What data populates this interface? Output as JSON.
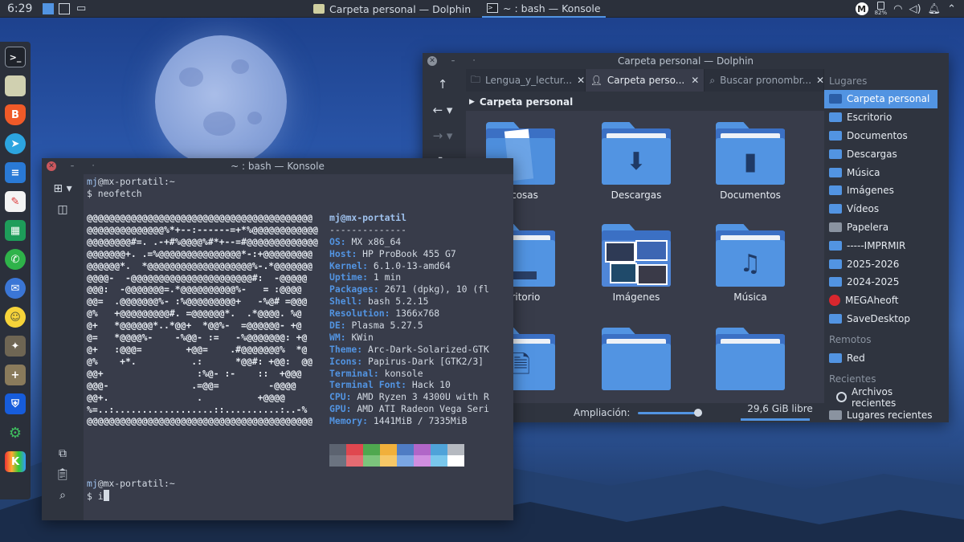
{
  "top_panel": {
    "clock": "6:29",
    "tasks": [
      {
        "title": "Carpeta personal — Dolphin",
        "active": false
      },
      {
        "title": "~ : bash — Konsole",
        "active": true
      }
    ],
    "battery": "82%"
  },
  "dock": {
    "icons": [
      "terminal-icon",
      "files-icon",
      "brave-icon",
      "telegram-icon",
      "writer-icon",
      "editor-icon",
      "sheets-icon",
      "chat-icon",
      "thunderbird-icon",
      "emoji-icon",
      "gimp-icon",
      "add-app-icon",
      "bitwarden-icon",
      "settings-icon",
      "kvirc-icon"
    ]
  },
  "dolphin": {
    "title": "Carpeta personal — Dolphin",
    "tabs": [
      "Lengua_y_lectur...",
      "Carpeta perso...",
      "Buscar pronombr..."
    ],
    "path": "Carpeta personal",
    "folders": [
      {
        "label": "+cosas",
        "glyph": ""
      },
      {
        "label": "Descargas",
        "glyph": "⬇"
      },
      {
        "label": "Documentos",
        "glyph": "▮"
      },
      {
        "label": "scritorio",
        "glyph": ""
      },
      {
        "label": "Imágenes",
        "glyph": ""
      },
      {
        "label": "Música",
        "glyph": "♫"
      },
      {
        "label": "",
        "glyph": "🗎"
      },
      {
        "label": "",
        "glyph": ""
      },
      {
        "label": "",
        "glyph": ""
      }
    ],
    "status": {
      "zoom_label": "Ampliación:",
      "free": "29,6 GiB libre",
      "edge_char": "s"
    },
    "places": {
      "head_lugares": "Lugares",
      "lugares": [
        "Carpeta personal",
        "Escritorio",
        "Documentos",
        "Descargas",
        "Música",
        "Imágenes",
        "Vídeos",
        "Papelera",
        "-----IMPRMIR",
        "2025-2026",
        "2024-2025",
        "MEGAheoft",
        "SaveDesktop"
      ],
      "head_remotos": "Remotos",
      "remotos": [
        "Red"
      ],
      "head_recientes": "Recientes",
      "recientes": [
        "Archivos recientes",
        "Lugares recientes"
      ]
    }
  },
  "konsole": {
    "title": "~ : bash — Konsole",
    "prompt_user": "mj",
    "prompt_host": "@mx-portatil",
    "prompt_path": ":~",
    "cmd1": "$ neofetch",
    "cmd2_prefix": "$ ",
    "cmd2_typed": "i",
    "art": "@@@@@@@@@@@@@@@@@@@@@@@@@@@@@@@@@@@@@@@@@\n@@@@@@@@@@@@@@%*+--:------=+*%@@@@@@@@@@@@\n@@@@@@@@#=. .-+#%@@@@%#*+--=#@@@@@@@@@@@@@\n@@@@@@@+. .=%@@@@@@@@@@@@@@@*-:+@@@@@@@@@\n@@@@@@*.  *@@@@@@@@@@@@@@@@@@@%-.*@@@@@@@\n@@@@-  -@@@@@@@@@@@@@@@@@@@@@@#:  -@@@@@\n@@@:  -@@@@@@@=.*@@@@@@@@@@%-   = :@@@@\n@@=  .@@@@@@@%- :%@@@@@@@@@+   -%@# =@@@\n@%   +@@@@@@@@@#. =@@@@@@*.  .*@@@@. %@\n@+   *@@@@@@*..*@@+  *@@%-  =@@@@@@- +@\n@=   *@@@@%-    -%@@- :=   -%@@@@@@@: +@\n@+   :@@@=        +@@=    .#@@@@@@@%  *@\n@%    +*.          .:      *@@#: +@@:  @@\n@@+                 :%@- :-    ::  +@@@\n@@@-               .=@@=         -@@@@\n@@+.                .          +@@@@\n%=..:..................::..........:..-%\n@@@@@@@@@@@@@@@@@@@@@@@@@@@@@@@@@@@@@@@@@",
    "info_header": "mj@mx-portatil",
    "info_sep": "--------------",
    "info": [
      {
        "k": "OS",
        "v": "MX x86_64"
      },
      {
        "k": "Host",
        "v": "HP ProBook 455 G7"
      },
      {
        "k": "Kernel",
        "v": "6.1.0-13-amd64"
      },
      {
        "k": "Uptime",
        "v": "1 min"
      },
      {
        "k": "Packages",
        "v": "2671 (dpkg), 10 (fl"
      },
      {
        "k": "Shell",
        "v": "bash 5.2.15"
      },
      {
        "k": "Resolution",
        "v": "1366x768"
      },
      {
        "k": "DE",
        "v": "Plasma 5.27.5"
      },
      {
        "k": "WM",
        "v": "KWin"
      },
      {
        "k": "Theme",
        "v": "Arc-Dark-Solarized-GTK"
      },
      {
        "k": "Icons",
        "v": "Papirus-Dark [GTK2/3]"
      },
      {
        "k": "Terminal",
        "v": "konsole"
      },
      {
        "k": "Terminal Font",
        "v": "Hack 10"
      },
      {
        "k": "CPU",
        "v": "AMD Ryzen 3 4300U with R"
      },
      {
        "k": "GPU",
        "v": "AMD ATI Radeon Vega Seri"
      },
      {
        "k": "Memory",
        "v": "1441MiB / 7335MiB"
      }
    ],
    "palette": [
      "#5c6370",
      "#e0474f",
      "#4fa84f",
      "#f1b03b",
      "#4f7cc4",
      "#b166c8",
      "#4fa3d9",
      "#b5b9c0",
      "#6b7380",
      "#e56b72",
      "#7cc47c",
      "#f6c766",
      "#7aa6e3",
      "#d08ee0",
      "#79c7ec",
      "#ffffff"
    ]
  }
}
